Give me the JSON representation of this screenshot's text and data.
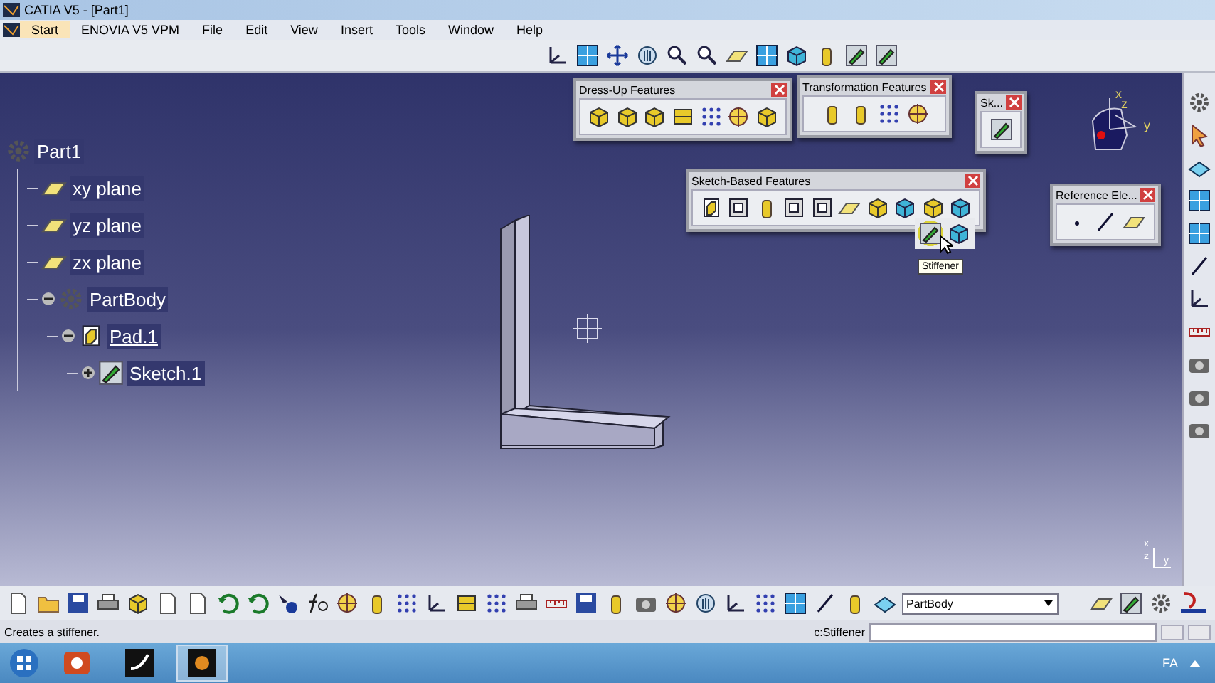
{
  "window": {
    "title": "CATIA V5 - [Part1]"
  },
  "menu": [
    {
      "label": "Start",
      "selected": true
    },
    {
      "label": "ENOVIA V5 VPM",
      "selected": false
    },
    {
      "label": "File",
      "selected": false
    },
    {
      "label": "Edit",
      "selected": false
    },
    {
      "label": "View",
      "selected": false
    },
    {
      "label": "Insert",
      "selected": false
    },
    {
      "label": "Tools",
      "selected": false
    },
    {
      "label": "Window",
      "selected": false
    },
    {
      "label": "Help",
      "selected": false
    }
  ],
  "tree": {
    "label": "Part1",
    "kind": "part",
    "children": [
      {
        "label": "xy plane",
        "kind": "plane",
        "selected": false
      },
      {
        "label": "yz plane",
        "kind": "plane",
        "selected": false
      },
      {
        "label": "zx plane",
        "kind": "plane",
        "selected": false
      },
      {
        "label": "PartBody",
        "kind": "body",
        "selected": false,
        "expanded": true,
        "children": [
          {
            "label": "Pad.1",
            "kind": "pad",
            "selected": true,
            "expanded": true,
            "children": [
              {
                "label": "Sketch.1",
                "kind": "sketch",
                "selected": false,
                "expanded": false
              }
            ]
          }
        ]
      }
    ]
  },
  "toolbars": [
    {
      "title": "Dress-Up Features"
    },
    {
      "title": "Transformation Features"
    },
    {
      "title": "Sk..."
    },
    {
      "title": "Sketch-Based Features"
    },
    {
      "title": "Reference Ele..."
    }
  ],
  "tooltip": "Stiffener",
  "compass_labels": [
    "x",
    "z",
    "y"
  ],
  "axis_labels": [
    "x",
    "z",
    "y"
  ],
  "current_body": "PartBody",
  "status_bar": {
    "message": "Creates a stiffener.",
    "command": "c:Stiffener"
  },
  "taskbar": {
    "language": "FA"
  }
}
